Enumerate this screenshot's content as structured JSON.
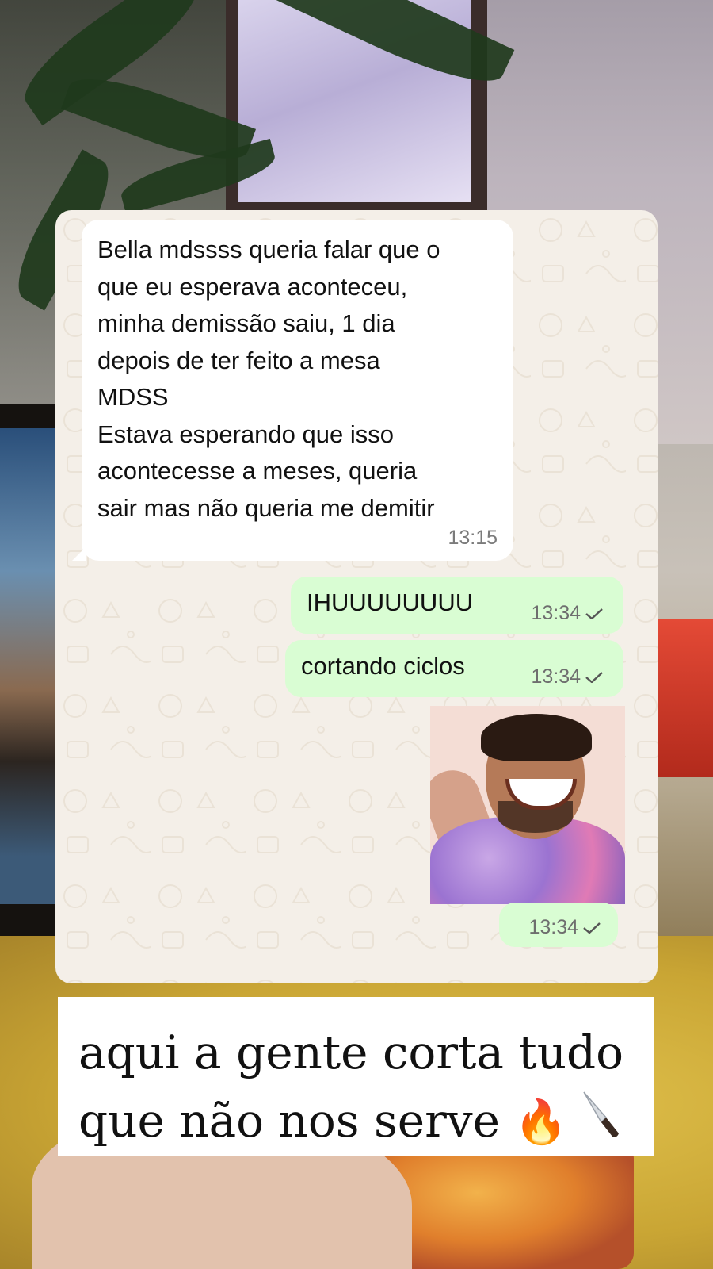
{
  "chat": {
    "incoming": {
      "text": "Bella mdssss queria falar que o\nque eu esperava aconteceu,\nminha demissão saiu, 1 dia\ndepois de ter feito a mesa\nMDSS\nEstava esperando que isso\nacontecesse a meses, queria\nsair mas não queria me demitir",
      "time": "13:15"
    },
    "outgoing": [
      {
        "text": "IHUUUUUUUU",
        "time": "13:34",
        "status_icon": "check-icon"
      },
      {
        "text": "cortando ciclos",
        "time": "13:34",
        "status_icon": "check-icon"
      },
      {
        "type": "image",
        "time": "13:34",
        "status_icon": "check-icon"
      }
    ],
    "colors": {
      "incoming_bubble": "#ffffff",
      "outgoing_bubble": "#d9fdd3",
      "wallpaper": "#f4efe8"
    }
  },
  "caption": {
    "line1": "aqui a gente corta tudo",
    "line2": "que não nos serve",
    "emoji1": "🔥",
    "emoji2_icon": "knife-icon"
  }
}
